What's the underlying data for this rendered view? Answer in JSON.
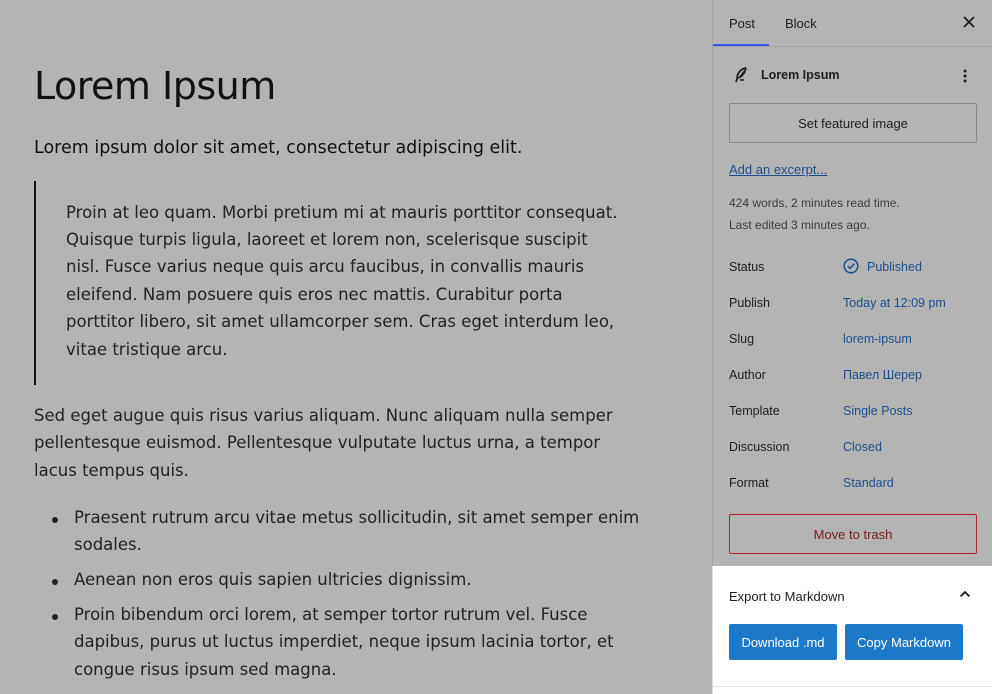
{
  "editor": {
    "title": "Lorem Ipsum",
    "intro": "Lorem ipsum dolor sit amet, consectetur adipiscing elit.",
    "quote_lines": [
      "Proin at leo quam. Morbi pretium mi at mauris porttitor consequat.",
      "Quisque turpis ligula, laoreet et lorem non, scelerisque suscipit",
      "nisl. Fusce varius neque quis arcu faucibus, in convallis mauris",
      "eleifend. Nam posuere quis eros nec mattis. Curabitur porta",
      "porttitor libero, sit amet ullamcorper sem. Cras eget interdum leo,",
      "vitae tristique arcu."
    ],
    "paragraph_lines": [
      "Sed eget augue quis risus varius aliquam. Nunc aliquam nulla semper",
      "pellentesque euismod. Pellentesque vulputate luctus urna, a tempor",
      "lacus tempus quis."
    ],
    "list_items": [
      [
        "Praesent rutrum arcu vitae metus sollicitudin, sit amet semper enim",
        "sodales."
      ],
      [
        "Aenean non eros quis sapien ultricies dignissim."
      ],
      [
        "Proin bibendum orci lorem, at semper tortor rutrum vel. Fusce",
        "dapibus, purus ut luctus imperdiet, neque ipsum lacinia tortor, et",
        "congue risus ipsum sed magna."
      ]
    ]
  },
  "sidebar": {
    "tabs": {
      "post": "Post",
      "block": "Block"
    },
    "close_icon": "close-icon",
    "doc_title": "Lorem Ipsum",
    "featured_image_label": "Set featured image",
    "excerpt_link": "Add an excerpt...",
    "meta_words": "424 words, 2 minutes read time.",
    "meta_edited": "Last edited 3 minutes ago.",
    "rows": [
      {
        "label": "Status",
        "value": "Published"
      },
      {
        "label": "Publish",
        "value": "Today at 12:09 pm"
      },
      {
        "label": "Slug",
        "value": "lorem-ipsum"
      },
      {
        "label": "Author",
        "value": "Павел Шерер"
      },
      {
        "label": "Template",
        "value": "Single Posts"
      },
      {
        "label": "Discussion",
        "value": "Closed"
      },
      {
        "label": "Format",
        "value": "Standard"
      }
    ],
    "trash_label": "Move to trash"
  },
  "export": {
    "title": "Export to Markdown",
    "download_label": "Download .md",
    "copy_label": "Copy Markdown"
  },
  "colors": {
    "accent": "#1e7ac8",
    "link": "#1e4f8c",
    "danger": "#b0262a",
    "overlay": "#b4b4b4"
  }
}
